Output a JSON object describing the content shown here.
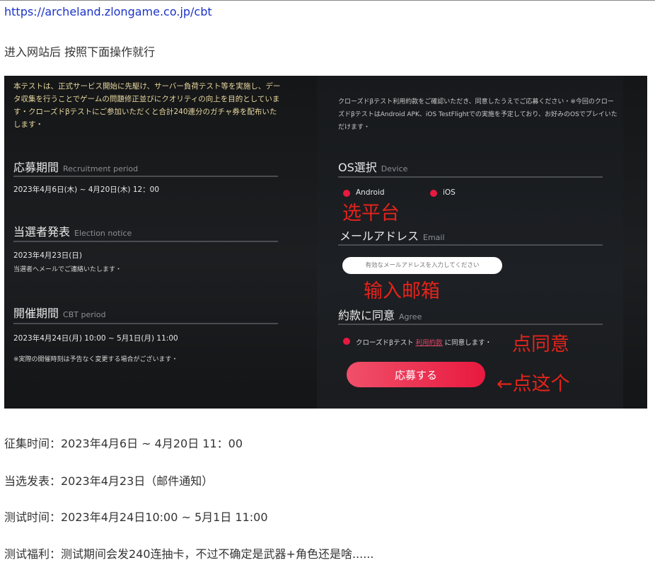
{
  "post": {
    "link": "https://archeland.zlongame.co.jp/cbt",
    "intro": "进入网站后 按照下面操作就行",
    "lines": [
      "征集时间：2023年4月6日 ~ 4月20日 11：00",
      "当选发表：2023年4月23日（邮件通知）",
      "测试时间：2023年4月24日10:00 ~ 5月1日 11:00",
      "测试福利：测试期间会发240连抽卡，不过不确定是武器+角色还是啥......"
    ]
  },
  "screenshot": {
    "left_intro": "本テストは、正式サービス開始に先駆け、サーバー負荷テスト等を実施し、データ収集を行うことでゲームの問題修正並びにクオリティの向上を目的としています・クローズドβテストにご参加いただくと合計240連分のガチャ券を配布いたします・",
    "recruit": {
      "title": "応募期間",
      "title_en": "Recruitment period",
      "value": "2023年4月6日(木) ~ 4月20日(木) 12：00"
    },
    "election": {
      "title": "当選者発表",
      "title_en": "Election notice",
      "value": "2023年4月23日(日)",
      "note": "当選者へメールでご連絡いたします・"
    },
    "cbt": {
      "title": "開催期間",
      "title_en": "CBT period",
      "value": "2023年4月24日(月) 10:00 ~ 5月1日(月) 11:00",
      "note": "※実際の開催時刻は予告なく変更する場合がございます・"
    },
    "right_intro": "クローズドβテスト利用約款をご確認いただき、同意したうえでご応募ください・※今回のクローズドβテストはAndroid APK、iOS TestFlightでの実施を予定しており、お好みのOSでプレイいただけます・",
    "os": {
      "title": "OS選択",
      "title_en": "Device",
      "options": [
        "Android",
        "iOS"
      ]
    },
    "email": {
      "title": "メールアドレス",
      "title_en": "Email",
      "placeholder": "有効なメールアドレスを入力してください"
    },
    "agree": {
      "title": "約款に同意",
      "title_en": "Agree",
      "text_before": "クローズドβテスト",
      "link": "利用約款",
      "text_after": "に同意します・"
    },
    "apply_label": "応募する",
    "annotations": {
      "platform": "选平台",
      "email": "输入邮箱",
      "agree": "点同意",
      "click": "←点这个"
    }
  },
  "colors": {
    "accent": "#e8193f",
    "annotation": "#e4231b",
    "link": "#1a33c8"
  }
}
